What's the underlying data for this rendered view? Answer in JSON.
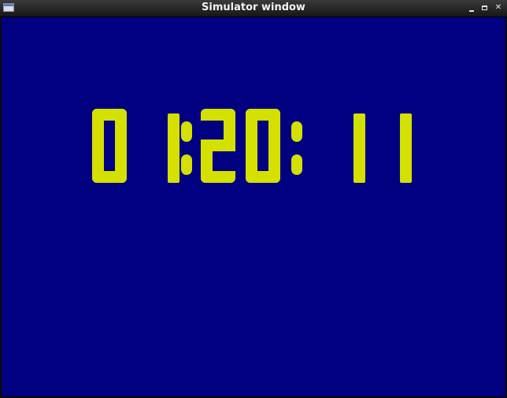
{
  "window": {
    "title": "Simulator window"
  },
  "colors": {
    "background": "#000080",
    "digits": "#d4e000"
  },
  "clock": {
    "time": "01:20:11",
    "hours": "01",
    "minutes": "20",
    "seconds": "11"
  },
  "icons": {
    "app": "app-icon",
    "minimize": "minimize-icon",
    "maximize": "maximize-icon",
    "close": "close-icon"
  }
}
